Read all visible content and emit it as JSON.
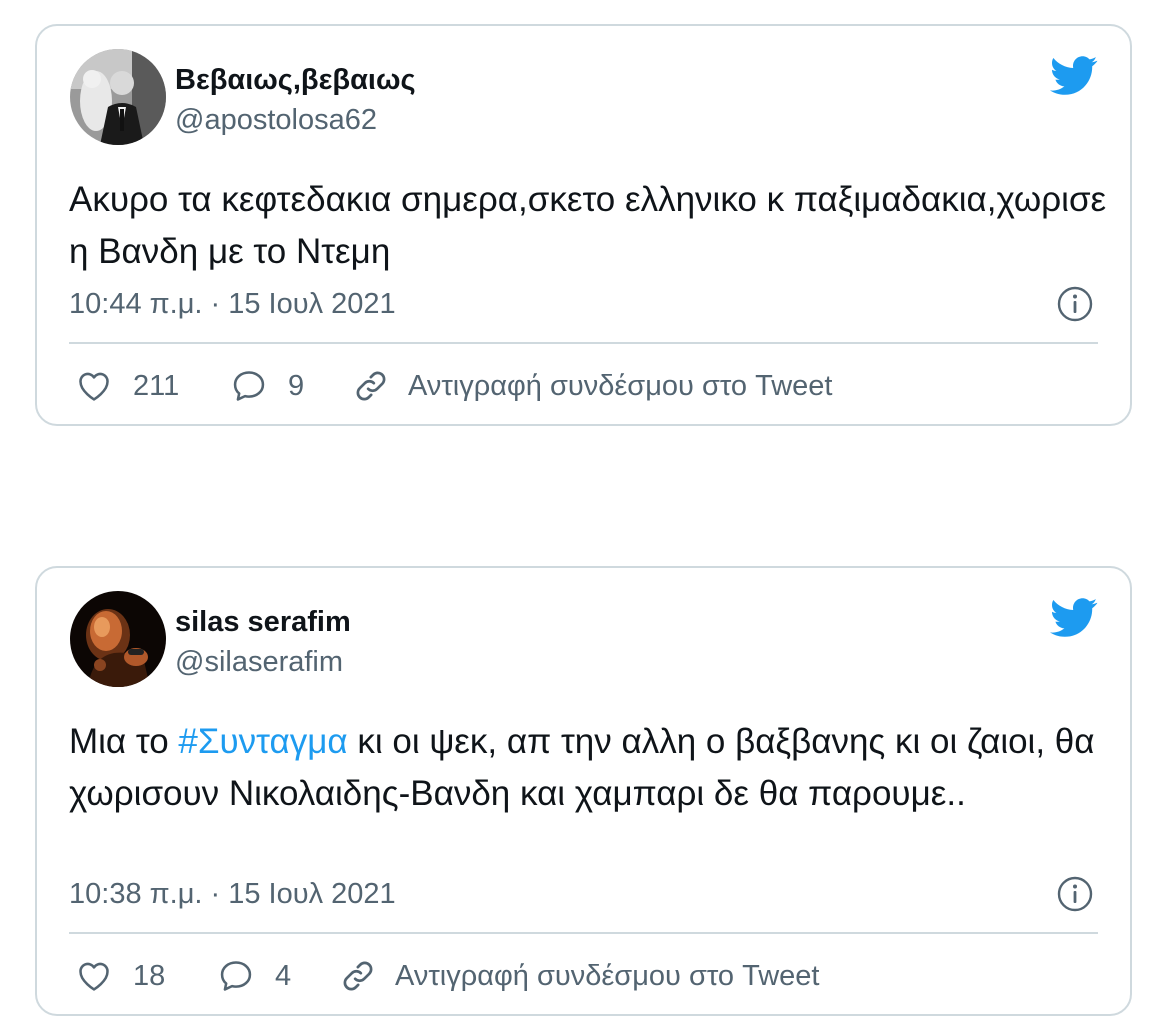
{
  "tweets": [
    {
      "author_name": "Βεβαιως,βεβαιως",
      "handle": "@apostolosa62",
      "text": "Ακυρο τα κεφτεδακια σημερα,σκετο ελληνικο κ παξιμαδακια,χωρισε  η Βανδη με το Ντεμη",
      "timestamp": "10:44 π.μ. · 15 Ιουλ 2021",
      "likes": "211",
      "replies": "9",
      "copy_link_label": "Αντιγραφή συνδέσμου στο Tweet"
    },
    {
      "author_name": "silas serafim",
      "handle": "@silaserafim",
      "text_before": "Μια το ",
      "hashtag": "#Συνταγμα",
      "text_after": " κι οι ψεκ, απ την αλλη ο βαξβανης κι οι ζαιοι, θα χωρισουν Νικολαιδης-Βανδη και χαμπαρι δε θα παρουμε..",
      "timestamp": "10:38 π.μ. · 15 Ιουλ 2021",
      "likes": "18",
      "replies": "4",
      "copy_link_label": "Αντιγραφή συνδέσμου στο Tweet"
    }
  ],
  "icons": {
    "brand": "twitter-bird-icon",
    "info": "info-icon",
    "like": "heart-icon",
    "reply": "speech-bubble-icon",
    "copy_link": "link-icon"
  },
  "colors": {
    "brand_blue": "#1d9bf0",
    "hashtag": "#1d9bf0",
    "secondary_text": "#536471",
    "border": "#cfd9de",
    "primary_text": "#0f1419"
  }
}
